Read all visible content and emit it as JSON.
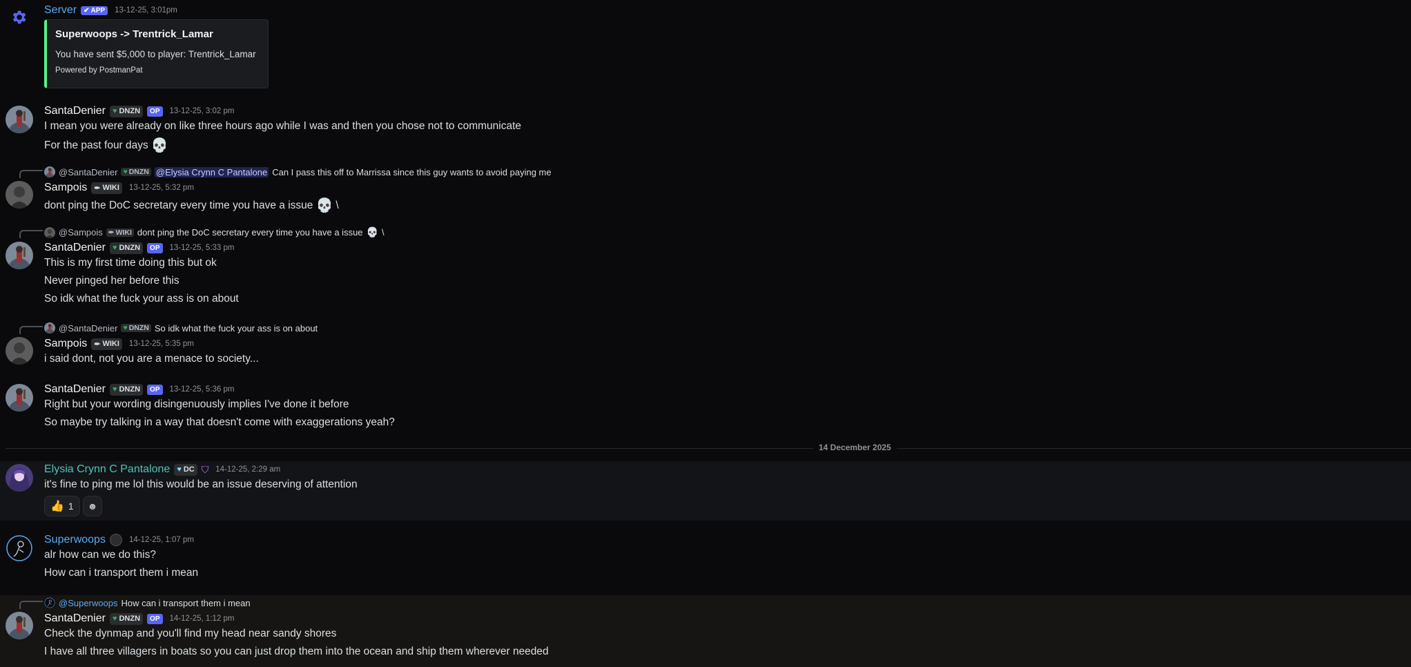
{
  "messages": {
    "server": {
      "name": "Server",
      "app_badge": "APP",
      "timestamp": "13-12-25, 3:01pm",
      "embed": {
        "title": "Superwoops -> Trentrick_Lamar",
        "description": "You have sent $5,000 to player: Trentrick_Lamar",
        "footer": "Powered by PostmanPat"
      }
    },
    "m1": {
      "name": "SantaDenier",
      "tag": "DNZN",
      "op": "OP",
      "timestamp": "13-12-25, 3:02 pm",
      "lines": [
        "I mean you were already on like three hours ago while I was and then you chose not to communicate",
        "For the past four days"
      ]
    },
    "m2": {
      "reply_name": "@SantaDenier",
      "reply_tag": "DNZN",
      "reply_mention": "@Elysia Crynn C Pantalone",
      "reply_text": "Can I pass this off to Marrissa since this guy wants to avoid paying me",
      "name": "Sampois",
      "tag": "WIKI",
      "timestamp": "13-12-25, 5:32 pm",
      "lines": [
        "dont ping the DoC secretary every time you have a issue",
        "\\"
      ]
    },
    "m3": {
      "reply_name": "@Sampois",
      "reply_tag": "WIKI",
      "reply_text": "dont ping the DoC secretary every time you have a issue",
      "reply_suffix": "\\",
      "name": "SantaDenier",
      "tag": "DNZN",
      "op": "OP",
      "timestamp": "13-12-25, 5:33 pm",
      "lines": [
        "This is my first time doing this but ok",
        "Never pinged her before this",
        "So idk what the fuck your ass is on about"
      ]
    },
    "m4": {
      "reply_name": "@SantaDenier",
      "reply_tag": "DNZN",
      "reply_text": "So idk what the fuck your ass is on about",
      "name": "Sampois",
      "tag": "WIKI",
      "timestamp": "13-12-25, 5:35 pm",
      "lines": [
        "i said dont, not you are a menace to society..."
      ]
    },
    "m5": {
      "name": "SantaDenier",
      "tag": "DNZN",
      "op": "OP",
      "timestamp": "13-12-25, 5:36 pm",
      "lines": [
        "Right but your wording disingenuously implies I've done it before",
        "So maybe try talking in a way that doesn't come with exaggerations yeah?"
      ]
    },
    "divider": "14 December 2025",
    "m6": {
      "name": "Elysia Crynn C Pantalone",
      "tag": "DC",
      "timestamp": "14-12-25, 2:29 am",
      "lines": [
        "it's fine to ping me lol this would be an issue deserving of attention"
      ],
      "reaction_count": "1"
    },
    "m7": {
      "name": "Superwoops",
      "timestamp": "14-12-25, 1:07 pm",
      "lines": [
        "alr how can we do this?",
        "How can i transport them i mean"
      ]
    },
    "m8": {
      "reply_name": "@Superwoops",
      "reply_text": "How can i transport them i mean",
      "name": "SantaDenier",
      "tag": "DNZN",
      "op": "OP",
      "timestamp": "14-12-25, 1:12 pm",
      "lines": [
        "Check the dynmap and you'll find my head near sandy shores",
        "I have all three villagers in boats so you can just drop them into the ocean and ship them wherever needed"
      ]
    }
  },
  "colors": {
    "name_server": "#5aa9f5",
    "name_elysia": "#4fc3b8",
    "name_superwoops": "#5aa9f5",
    "embed_accent": "#57f287",
    "op_badge": "#5865f2"
  }
}
